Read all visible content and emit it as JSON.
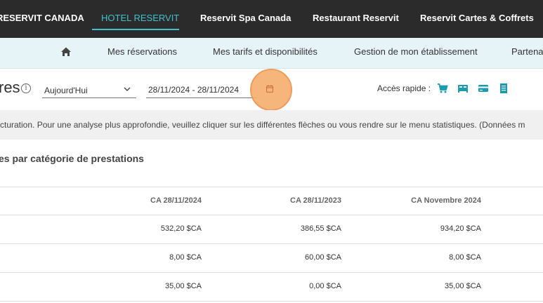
{
  "topnav": {
    "tabs": [
      {
        "label": "RESERVIT CANADA"
      },
      {
        "label": "HOTEL RESERVIT"
      },
      {
        "label": "Reservit Spa Canada"
      },
      {
        "label": "Restaurant Reservit"
      },
      {
        "label": "Reservit Cartes & Coffrets"
      }
    ],
    "active_color": "#3fc1cf"
  },
  "subnav": {
    "home_icon": "home-icon",
    "items": [
      {
        "label": "Mes réservations"
      },
      {
        "label": "Mes tarifs et disponibilités"
      },
      {
        "label": "Gestion de mon établissement"
      },
      {
        "label": "Partena"
      }
    ]
  },
  "toolbar": {
    "title": "res",
    "period_value": "Aujourd'Hui",
    "date_range": "28/11/2024 - 28/11/2024",
    "quick_access_label": "Accès rapide :",
    "quick_icons": [
      "cart-icon",
      "bed-icon",
      "card-icon",
      "receipt-icon"
    ],
    "accent_color": "#1a9bb0",
    "highlight_color": "#f6ad6c"
  },
  "banner": {
    "text": "cturation. Pour une analyse plus approfondie, veuillez cliquer sur les différentes flèches ou vous rendre sur le menu statistiques. (Données m"
  },
  "section": {
    "title": "es par catégorie de prestations"
  },
  "table": {
    "headers": [
      "CA 28/11/2024",
      "CA 28/11/2023",
      "CA Novembre 2024"
    ],
    "rows": [
      [
        "532,20 $CA",
        "386,55 $CA",
        "934,20 $CA"
      ],
      [
        "8,00 $CA",
        "60,00 $CA",
        "8,00 $CA"
      ],
      [
        "35,00 $CA",
        "0,00 $CA",
        "35,00 $CA"
      ]
    ]
  }
}
